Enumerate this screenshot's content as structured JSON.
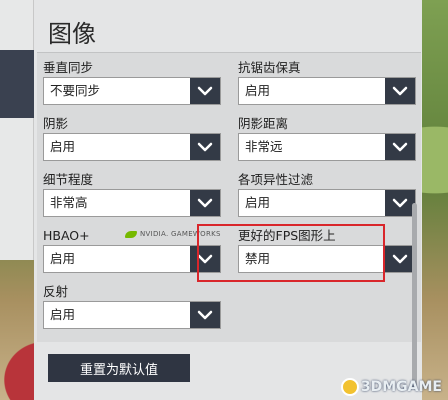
{
  "panel": {
    "title": "图像"
  },
  "settings": {
    "vsync": {
      "label": "垂直同步",
      "value": "不要同步"
    },
    "antialias": {
      "label": "抗锯齿保真",
      "value": "启用"
    },
    "shadow": {
      "label": "阴影",
      "value": "启用"
    },
    "shadow_distance": {
      "label": "阴影距离",
      "value": "非常远"
    },
    "detail": {
      "label": "细节程度",
      "value": "非常高"
    },
    "anisotropic": {
      "label": "各项异性过滤",
      "value": "启用"
    },
    "hbao": {
      "label": "HBAO+",
      "value": "启用",
      "badge": "NVIDIA. GAMEWORKS"
    },
    "fps_graphics": {
      "label": "更好的FPS图形上",
      "value": "禁用"
    },
    "reflection": {
      "label": "反射",
      "value": "启用"
    }
  },
  "reset_button": {
    "label": "重置为默认值"
  },
  "watermark": {
    "text": "3DMGAME"
  },
  "colors": {
    "dropdown_arrow_bg": "#333a46",
    "highlight": "#d9262b",
    "nvidia_green": "#76b900"
  },
  "icons": {
    "dropdown": "chevron-down-icon",
    "vendor": "nvidia-logo-icon"
  }
}
